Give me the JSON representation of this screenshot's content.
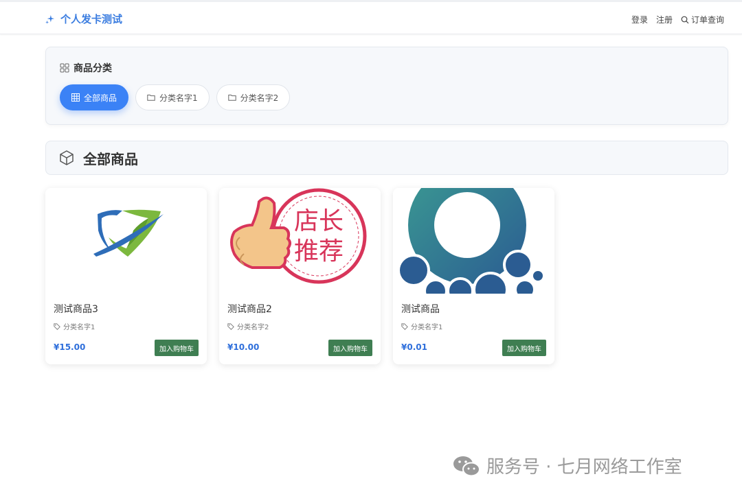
{
  "navbar": {
    "brand": "个人发卡测试",
    "links": [
      "登录",
      "注册",
      "订单查询"
    ]
  },
  "categories": {
    "title": "商品分类",
    "items": [
      "全部商品",
      "分类名字1",
      "分类名字2"
    ],
    "active_index": 0
  },
  "section": {
    "title": "全部商品"
  },
  "products": [
    {
      "name": "测试商品3",
      "category": "分类名字1",
      "price": "¥15.00",
      "cart_label": "加入购物车",
      "image": "shield-logo"
    },
    {
      "name": "测试商品2",
      "category": "分类名字2",
      "price": "¥10.00",
      "cart_label": "加入购物车",
      "image": "recommend-badge",
      "image_text": [
        "店长",
        "推荐"
      ]
    },
    {
      "name": "测试商品",
      "category": "分类名字1",
      "price": "¥0.01",
      "cart_label": "加入购物车",
      "image": "teal-circle-logo"
    }
  ],
  "watermark": {
    "text": "服务号 · 七月网络工作室"
  },
  "colors": {
    "accent": "#3b82f6",
    "cart_button": "#3f7e52",
    "price": "#2f6fdb"
  }
}
